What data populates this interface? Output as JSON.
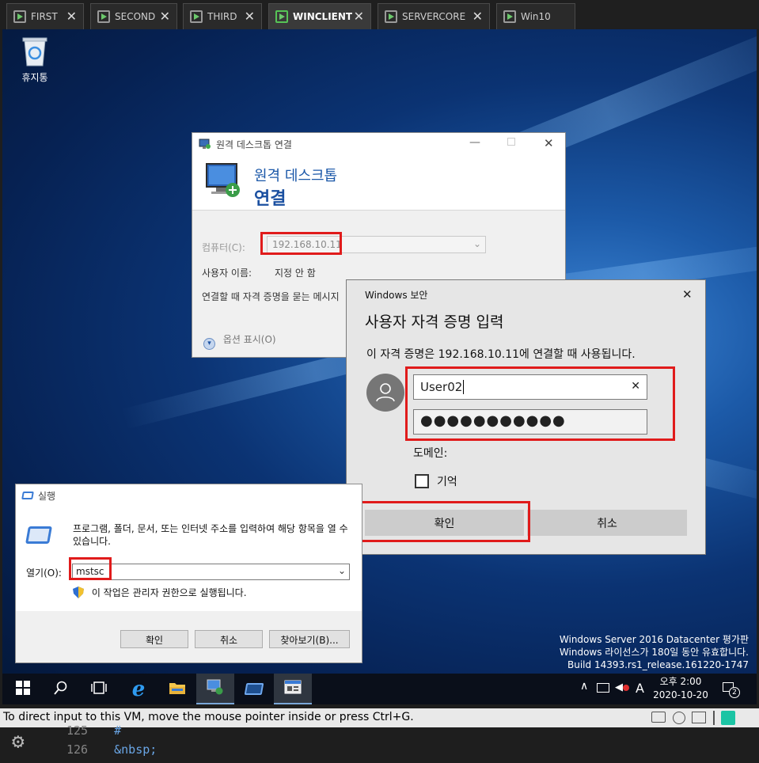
{
  "vm_tabs": [
    {
      "label": "FIRST"
    },
    {
      "label": "SECOND"
    },
    {
      "label": "THIRD"
    },
    {
      "label": "WINCLIENT"
    },
    {
      "label": "SERVERCORE"
    },
    {
      "label": "Win10"
    }
  ],
  "desktop": {
    "recycle_bin_label": "휴지통",
    "watermark": {
      "line1": "Windows Server 2016 Datacenter 평가판",
      "line2": "Windows 라이선스가 180일 동안 유효합니다.",
      "line3": "Build 14393.rs1_release.161220-1747"
    }
  },
  "rdp_window": {
    "title": "원격 데스크톱 연결",
    "header_line1": "원격 데스크톱",
    "header_line2": "연결",
    "computer_label": "컴퓨터(C):",
    "computer_value": "192.168.10.11",
    "username_label": "사용자 이름:",
    "username_value": "지정 안 함",
    "prompt_text": "연결할 때 자격 증명을 묻는 메시지",
    "options_label": "옵션 표시(O)"
  },
  "security_dialog": {
    "title": "Windows 보안",
    "heading": "사용자 자격 증명 입력",
    "description": "이 자격 증명은 192.168.10.11에 연결할 때 사용됩니다.",
    "username_value": "User02",
    "password_mask": "●●●●●●●●●●●",
    "domain_label": "도메인:",
    "remember_label": "기억",
    "ok_label": "확인",
    "cancel_label": "취소"
  },
  "run_dialog": {
    "title": "실행",
    "description": "프로그램, 폴더, 문서, 또는 인터넷 주소를 입력하여 해당 항목을 열 수 있습니다.",
    "open_label": "열기(O):",
    "open_value": "mstsc",
    "admin_note": "이 작업은 관리자 권한으로 실행됩니다.",
    "ok_label": "확인",
    "cancel_label": "취소",
    "browse_label": "찾아보기(B)..."
  },
  "taskbar": {
    "time": "오후 2:00",
    "date": "2020-10-20",
    "ime_label": "A",
    "notification_count": "2"
  },
  "status_bar": {
    "message": "To direct input to this VM, move the mouse pointer inside or press Ctrl+G."
  },
  "editor": {
    "lines": [
      {
        "number": "125",
        "text": "#"
      },
      {
        "number": "126",
        "text": "&nbsp;"
      }
    ]
  },
  "colors": {
    "highlight_red": "#e01b1b",
    "rdp_blue": "#1a57a8",
    "active_tab_green": "#56c456"
  }
}
